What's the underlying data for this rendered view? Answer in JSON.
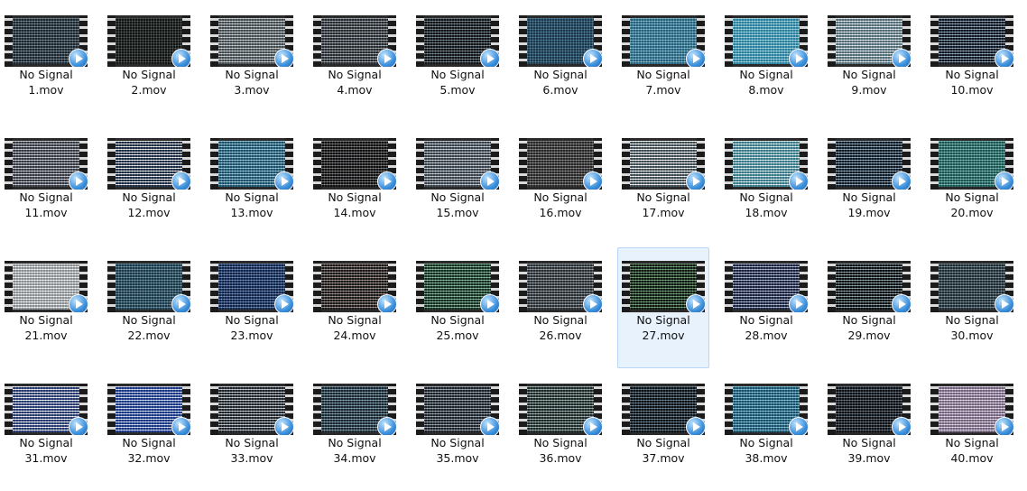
{
  "files": [
    {
      "line1": "No Signal",
      "line2": "1.mov",
      "c1": "#1f2a33",
      "c2": "#6a7a86"
    },
    {
      "line1": "No Signal",
      "line2": "2.mov",
      "c1": "#141616",
      "c2": "#3b4142"
    },
    {
      "line1": "No Signal",
      "line2": "3.mov",
      "c1": "#4b5357",
      "c2": "#c9d0d4"
    },
    {
      "line1": "No Signal",
      "line2": "4.mov",
      "c1": "#2a2f34",
      "c2": "#9aa3aa"
    },
    {
      "line1": "No Signal",
      "line2": "5.mov",
      "c1": "#121517",
      "c2": "#6b7d88"
    },
    {
      "line1": "No Signal",
      "line2": "6.mov",
      "c1": "#1d3f55",
      "c2": "#3d6f8c"
    },
    {
      "line1": "No Signal",
      "line2": "7.mov",
      "c1": "#2b6e8c",
      "c2": "#79b2c9"
    },
    {
      "line1": "No Signal",
      "line2": "8.mov",
      "c1": "#2f8fae",
      "c2": "#9fd3e3"
    },
    {
      "line1": "No Signal",
      "line2": "9.mov",
      "c1": "#5b7884",
      "c2": "#e7eef1"
    },
    {
      "line1": "No Signal",
      "line2": "10.mov",
      "c1": "#111822",
      "c2": "#8aa2b7"
    },
    {
      "line1": "No Signal",
      "line2": "11.mov",
      "c1": "#3a3e46",
      "c2": "#c7ccd6"
    },
    {
      "line1": "No Signal",
      "line2": "12.mov",
      "c1": "#20304a",
      "c2": "#f2f2f2"
    },
    {
      "line1": "No Signal",
      "line2": "13.mov",
      "c1": "#1f5a77",
      "c2": "#93c4d8"
    },
    {
      "line1": "No Signal",
      "line2": "14.mov",
      "c1": "#111111",
      "c2": "#6d6f72"
    },
    {
      "line1": "No Signal",
      "line2": "15.mov",
      "c1": "#3c4650",
      "c2": "#c9d0d6"
    },
    {
      "line1": "No Signal",
      "line2": "16.mov",
      "c1": "#2b2b2b",
      "c2": "#7d7d7d"
    },
    {
      "line1": "No Signal",
      "line2": "17.mov",
      "c1": "#43525a",
      "c2": "#ffffff"
    },
    {
      "line1": "No Signal",
      "line2": "18.mov",
      "c1": "#3f8696",
      "c2": "#dff2f6"
    },
    {
      "line1": "No Signal",
      "line2": "19.mov",
      "c1": "#0f1c28",
      "c2": "#8aa4b9"
    },
    {
      "line1": "No Signal",
      "line2": "20.mov",
      "c1": "#1e5e5c",
      "c2": "#6fb3ab"
    },
    {
      "line1": "No Signal",
      "line2": "21.mov",
      "c1": "#9aa0a4",
      "c2": "#f4f5f6"
    },
    {
      "line1": "No Signal",
      "line2": "22.mov",
      "c1": "#1e4052",
      "c2": "#5f8899"
    },
    {
      "line1": "No Signal",
      "line2": "23.mov",
      "c1": "#13284f",
      "c2": "#5f7fb1"
    },
    {
      "line1": "No Signal",
      "line2": "24.mov",
      "c1": "#1a1a1a",
      "c2": "#9b8a84"
    },
    {
      "line1": "No Signal",
      "line2": "25.mov",
      "c1": "#153222",
      "c2": "#83b59b"
    },
    {
      "line1": "No Signal",
      "line2": "26.mov",
      "c1": "#2b3237",
      "c2": "#8e979c"
    },
    {
      "line1": "No Signal",
      "line2": "27.mov",
      "c1": "#0f1b12",
      "c2": "#6a9a6f",
      "selected": true
    },
    {
      "line1": "No Signal",
      "line2": "28.mov",
      "c1": "#1b2540",
      "c2": "#aab6d6"
    },
    {
      "line1": "No Signal",
      "line2": "29.mov",
      "c1": "#0a0d0f",
      "c2": "#8aa0a9"
    },
    {
      "line1": "No Signal",
      "line2": "30.mov",
      "c1": "#213038",
      "c2": "#6e838c"
    },
    {
      "line1": "No Signal",
      "line2": "31.mov",
      "c1": "#2a3f79",
      "c2": "#f4f6fb"
    },
    {
      "line1": "No Signal",
      "line2": "32.mov",
      "c1": "#1a3b8f",
      "c2": "#d8e0f7"
    },
    {
      "line1": "No Signal",
      "line2": "33.mov",
      "c1": "#1f262c",
      "c2": "#c7ced4"
    },
    {
      "line1": "No Signal",
      "line2": "34.mov",
      "c1": "#1b2a35",
      "c2": "#7a9aa8"
    },
    {
      "line1": "No Signal",
      "line2": "35.mov",
      "c1": "#1d232b",
      "c2": "#9aa6b3"
    },
    {
      "line1": "No Signal",
      "line2": "36.mov",
      "c1": "#202b2a",
      "c2": "#9bb2af"
    },
    {
      "line1": "No Signal",
      "line2": "37.mov",
      "c1": "#0c1216",
      "c2": "#5f7787"
    },
    {
      "line1": "No Signal",
      "line2": "38.mov",
      "c1": "#1c5977",
      "c2": "#7cc1d9"
    },
    {
      "line1": "No Signal",
      "line2": "39.mov",
      "c1": "#0f1114",
      "c2": "#586774"
    },
    {
      "line1": "No Signal",
      "line2": "40.mov",
      "c1": "#7f6d8a",
      "c2": "#e6dced"
    }
  ]
}
